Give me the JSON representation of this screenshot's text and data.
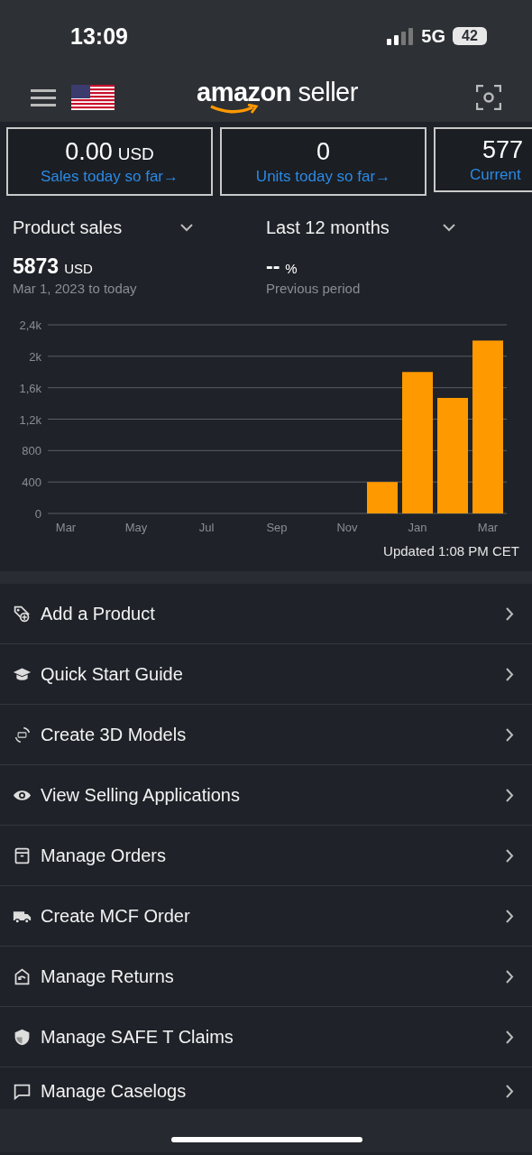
{
  "status_bar": {
    "time": "13:09",
    "network": "5G",
    "battery": "42"
  },
  "header": {
    "logo_brand": "amazon",
    "logo_suffix": "seller"
  },
  "metrics": [
    {
      "value": "0.00",
      "unit": "USD",
      "label": "Sales today so far",
      "arrow": "→"
    },
    {
      "value": "0",
      "label": "Units today so far",
      "arrow": "→"
    },
    {
      "value": "577",
      "label": "Current"
    }
  ],
  "summary": {
    "metric_select": "Product sales",
    "period_select": "Last 12 months",
    "total": "5873",
    "total_unit": "USD",
    "range": "Mar 1, 2023 to today",
    "change": "--",
    "change_unit": "%",
    "change_label": "Previous period"
  },
  "chart": {
    "chart_data": {
      "type": "bar",
      "categories": [
        "Mar",
        null,
        "May",
        null,
        "Jul",
        null,
        "Sep",
        null,
        "Nov",
        null,
        "Jan",
        null,
        "Mar"
      ],
      "values": [
        0,
        0,
        0,
        0,
        0,
        0,
        0,
        0,
        0,
        400,
        1800,
        1470,
        2200
      ],
      "ylim": [
        0,
        2400
      ],
      "grid": true,
      "yticks": [
        {
          "value": 0,
          "label": "0"
        },
        {
          "value": 400,
          "label": "400"
        },
        {
          "value": 800,
          "label": "800"
        },
        {
          "value": 1200,
          "label": "1,2k"
        },
        {
          "value": 1600,
          "label": "1,6k"
        },
        {
          "value": 2000,
          "label": "2k"
        },
        {
          "value": 2400,
          "label": "2,4k"
        }
      ]
    },
    "updated": "Updated 1:08 PM CET"
  },
  "menu": [
    {
      "kind": "tag",
      "label": "Add a Product"
    },
    {
      "kind": "cap",
      "label": "Quick Start Guide"
    },
    {
      "kind": "model3d",
      "label": "Create 3D Models"
    },
    {
      "kind": "eye",
      "label": "View Selling Applications"
    },
    {
      "kind": "box",
      "label": "Manage Orders"
    },
    {
      "kind": "truck",
      "label": "Create MCF Order"
    },
    {
      "kind": "returns",
      "label": "Manage Returns"
    },
    {
      "kind": "shield",
      "label": "Manage SAFE T Claims"
    },
    {
      "kind": "chat",
      "label": "Manage Caselogs"
    }
  ]
}
